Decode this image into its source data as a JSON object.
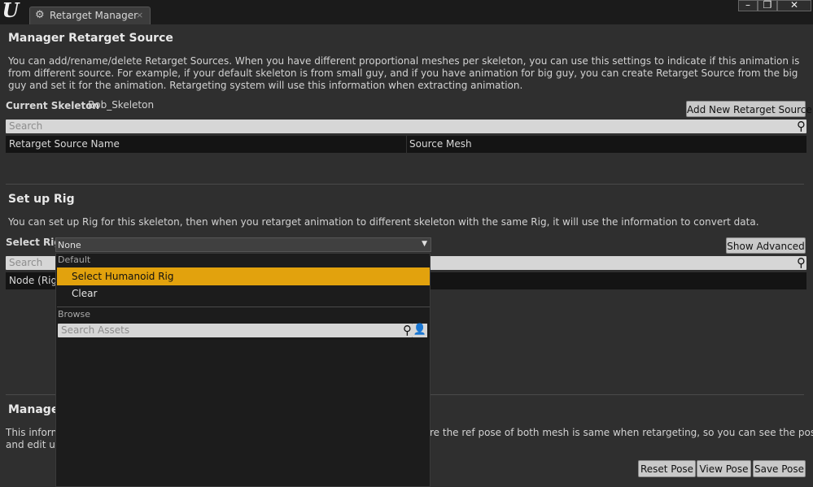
{
  "window": {
    "tab_title": "Retarget Manager",
    "tab_icon": "gear-icon",
    "tab_close": "×",
    "minimize": "–",
    "maximize": "❐",
    "close": "✕"
  },
  "retarget_source": {
    "title": "Manager Retarget Source",
    "description": "You can add/rename/delete Retarget Sources. When you have different proportional meshes per skeleton, you can use this settings to indicate if this animation is from different source. For example, if your default skeleton is from small guy, and if you have animation for big guy, you can create Retarget Source from the big guy and set it for the animation. Retargeting system will use this information when extracting animation.",
    "current_skeleton_label": "Current Skeleton",
    "current_skeleton_value": "Bob_Skeleton",
    "add_button": "Add New Retarget Source",
    "search_placeholder": "Search",
    "columns": [
      "Retarget Source Name",
      "Source Mesh"
    ]
  },
  "setup_rig": {
    "title": "Set up Rig",
    "description": "You can set up Rig for this skeleton, then when you retarget animation to different skeleton with the same Rig, it will use the information to convert data.",
    "select_rig_label": "Select Rig",
    "select_rig_value": "None",
    "show_advanced": "Show Advanced",
    "search_placeholder": "Search",
    "column": "Node (Rig)"
  },
  "manage_pose": {
    "title_visible": "Manage",
    "description_line1_left": "This inform",
    "description_line1_right": "re the ref pose of both mesh is same when retargeting, so you can see the pose",
    "description_line2_left": "and edit us",
    "reset_pose": "Reset Pose",
    "view_pose": "View Pose",
    "save_pose": "Save Pose"
  },
  "dropdown": {
    "default_header": "Default",
    "items": [
      "Select Humanoid Rig",
      "Clear"
    ],
    "selected_index": 0,
    "browse_header": "Browse",
    "search_placeholder": "Search Assets",
    "accent": "#e2a20d"
  }
}
